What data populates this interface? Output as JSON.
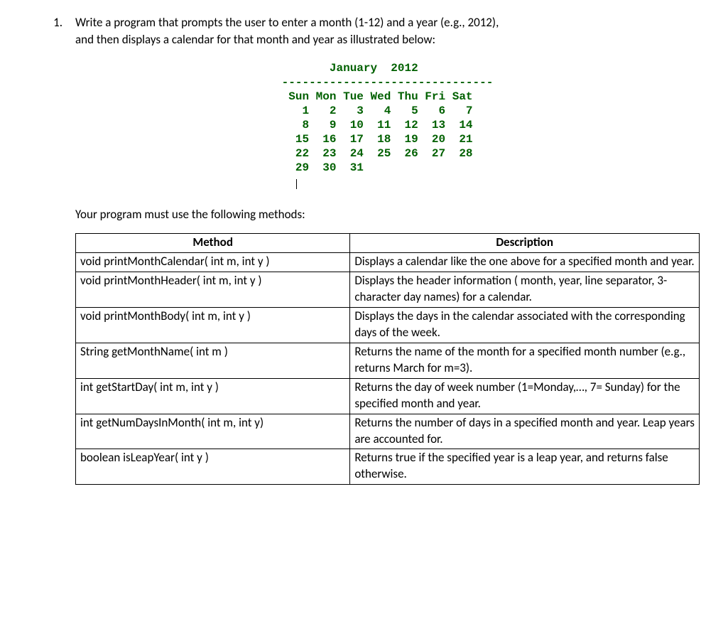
{
  "question_number": "1.",
  "prompt_line1": "Write a program that prompts the user to enter a month (1-12) and a year (e.g., 2012),",
  "prompt_line2": "and then displays a calendar for that month and year as illustrated below:",
  "calendar_title": "       January  2012",
  "calendar_rule": "-------------------------------",
  "calendar_days": " Sun Mon Tue Wed Thu Fri Sat",
  "calendar_rows": [
    "   1   2   3   4   5   6   7",
    "   8   9  10  11  12  13  14",
    "  15  16  17  18  19  20  21",
    "  22  23  24  25  26  27  28",
    "  29  30  31"
  ],
  "subprompt": "Your program must use the following methods:",
  "table": {
    "headers": [
      "Method",
      "Description"
    ],
    "rows": [
      {
        "method": "void printMonthCalendar( int m, int y )",
        "desc": "Displays a calendar like the one above for a specified month and year."
      },
      {
        "method": "void printMonthHeader( int m, int y )",
        "desc": "Displays the header information ( month, year, line separator, 3-character day names) for a calendar."
      },
      {
        "method": "void printMonthBody( int m, int y )",
        "desc": "Displays the days in the calendar associated with the corresponding days of the week."
      },
      {
        "method": "String getMonthName( int m )",
        "desc": "Returns the name of the month for a specified month number (e.g., returns March for m=3)."
      },
      {
        "method": "int getStartDay( int m, int y )",
        "desc": "Returns the day of week  number (1=Monday,…, 7= Sunday) for the specified month and year."
      },
      {
        "method": "int getNumDaysInMonth( int m, int y)",
        "desc": "Returns the number of days in a specified month and year. Leap years are accounted for."
      },
      {
        "method": "boolean isLeapYear( int y )",
        "desc": "Returns true if the specified year is a leap year, and returns false otherwise."
      }
    ]
  }
}
